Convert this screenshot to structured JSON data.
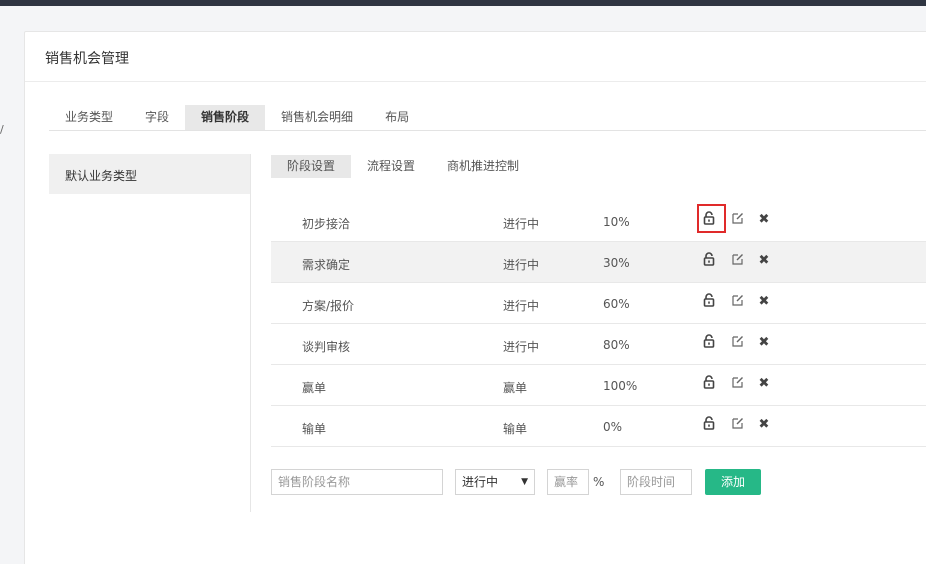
{
  "page": {
    "title": "销售机会管理"
  },
  "edge_mark": "/",
  "tabs": [
    {
      "label": "业务类型"
    },
    {
      "label": "字段"
    },
    {
      "label": "销售阶段",
      "active": true
    },
    {
      "label": "销售机会明细"
    },
    {
      "label": "布局"
    }
  ],
  "sidebar": {
    "items": [
      {
        "label": "默认业务类型",
        "selected": true
      }
    ]
  },
  "subtabs": [
    {
      "label": "阶段设置",
      "active": true
    },
    {
      "label": "流程设置"
    },
    {
      "label": "商机推进控制"
    }
  ],
  "stages": [
    {
      "name": "初步接洽",
      "status": "进行中",
      "rate": "10%"
    },
    {
      "name": "需求确定",
      "status": "进行中",
      "rate": "30%"
    },
    {
      "name": "方案/报价",
      "status": "进行中",
      "rate": "60%"
    },
    {
      "name": "谈判审核",
      "status": "进行中",
      "rate": "80%"
    },
    {
      "name": "赢单",
      "status": "赢单",
      "rate": "100%"
    },
    {
      "name": "输单",
      "status": "输单",
      "rate": "0%"
    }
  ],
  "row_icons": [
    "unlock-icon",
    "edit-icon",
    "close-icon"
  ],
  "form": {
    "name_placeholder": "销售阶段名称",
    "status_value": "进行中",
    "rate_placeholder": "赢率",
    "percent_sign": "%",
    "time_placeholder": "阶段时间",
    "add_label": "添加"
  },
  "colors": {
    "accent": "#26b887",
    "highlight": "#e02a2a",
    "topbar": "#2f3542"
  }
}
